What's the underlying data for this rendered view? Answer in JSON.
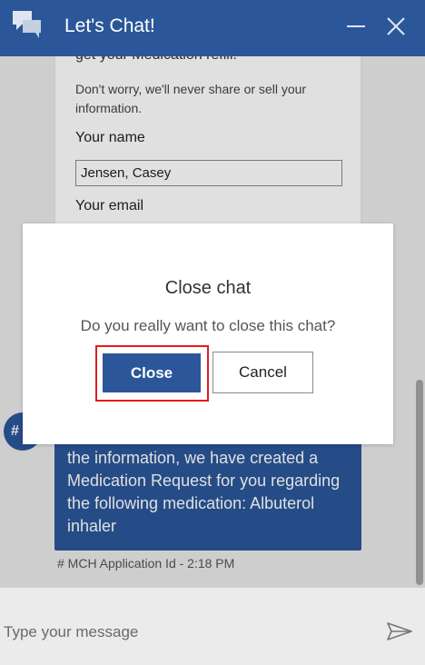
{
  "header": {
    "title": "Let's Chat!",
    "icons": {
      "chat": "chat-bubbles-icon",
      "minimize": "minimize-icon",
      "close": "close-icon"
    }
  },
  "form": {
    "cut_text": "get your Medication refill.",
    "note": "Don't worry, we'll never share or sell your information.",
    "name_label": "Your name",
    "name_value": "Jensen, Casey",
    "email_label": "Your email"
  },
  "messages": {
    "avatar_text": "#",
    "bot_text": "the information, we have created a Medication Request for you regarding the following medication: Albuterol inhaler",
    "meta": "# MCH Application Id - 2:18 PM"
  },
  "modal": {
    "title": "Close chat",
    "message": "Do you really want to close this chat?",
    "confirm_label": "Close",
    "cancel_label": "Cancel"
  },
  "composer": {
    "placeholder": "Type your message",
    "send_icon": "send-icon"
  },
  "colors": {
    "brand": "#2b579a",
    "highlight": "#e11d1d"
  }
}
